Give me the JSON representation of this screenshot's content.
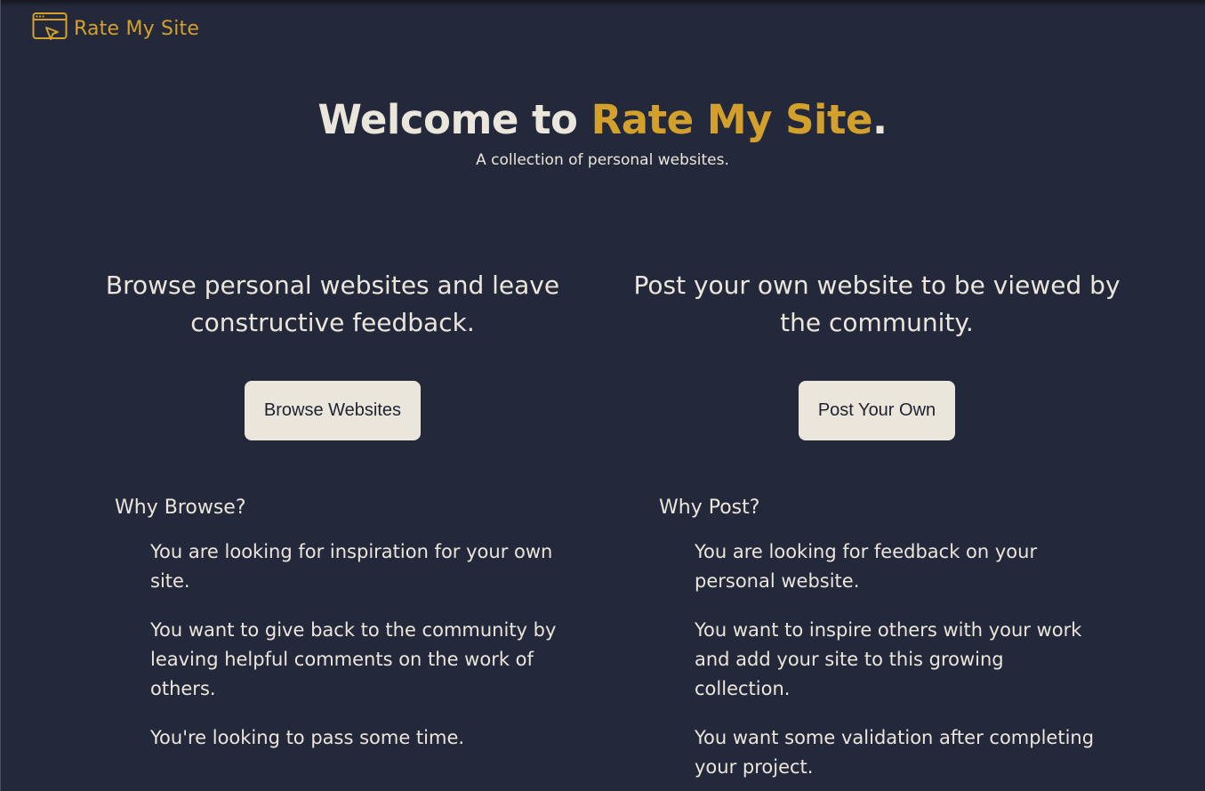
{
  "header": {
    "brand": "Rate My Site",
    "brand_color": "#d4a02c",
    "logo_icon": "browser-window-cursor-icon"
  },
  "hero": {
    "title_prefix": "Welcome to ",
    "title_accent": "Rate My Site",
    "title_suffix": ".",
    "subtitle": "A collection of personal websites."
  },
  "browse": {
    "heading": "Browse personal websites and leave constructive feedback.",
    "button_label": "Browse Websites",
    "why_title": "Why Browse?",
    "reasons": [
      "You are looking for inspiration for your own site.",
      "You want to give back to the community by leaving helpful comments on the work of others.",
      "You're looking to pass some time."
    ]
  },
  "post": {
    "heading": "Post your own website to be viewed by the community.",
    "button_label": "Post Your Own",
    "why_title": "Why Post?",
    "reasons": [
      "You are looking for feedback on your personal website.",
      "You want to inspire others with your work and add your site to this growing collection.",
      "You want some validation after completing your project."
    ]
  },
  "colors": {
    "background": "#23283a",
    "text": "#ebe6dc",
    "accent": "#d4a02c",
    "button_bg": "#ebe6dc",
    "button_text": "#1e2230"
  }
}
